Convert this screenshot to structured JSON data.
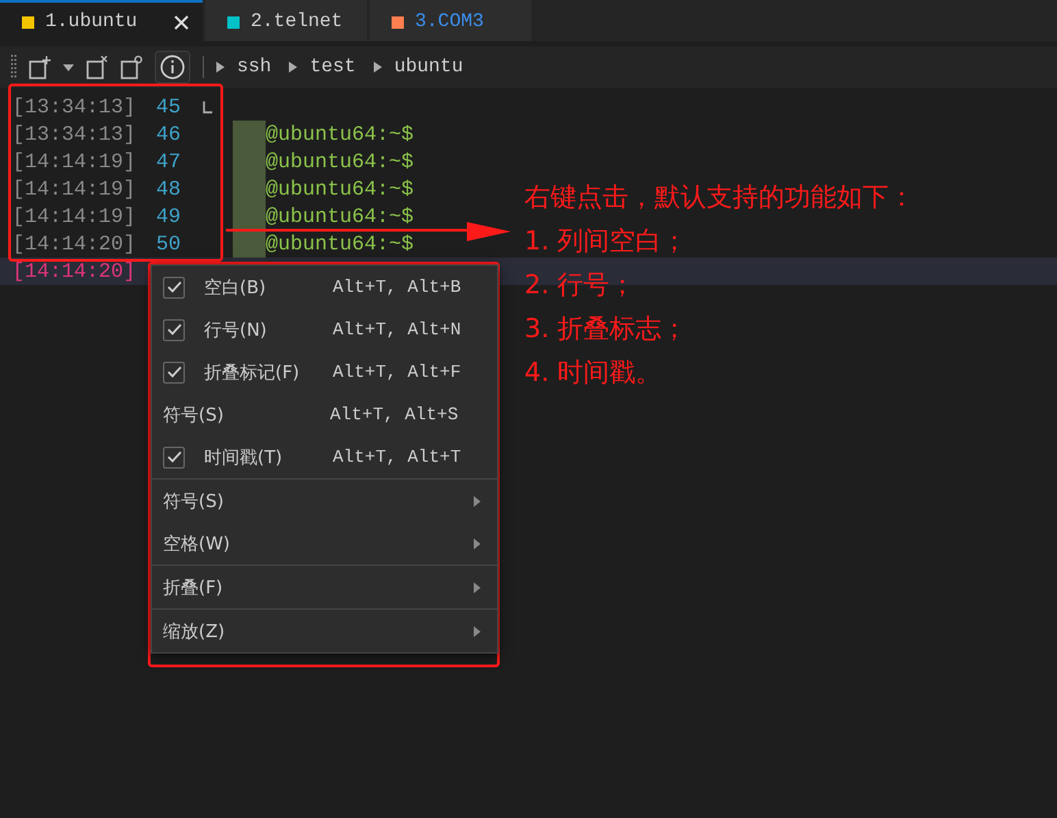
{
  "tabs": [
    {
      "label": "1.ubuntu",
      "selected": true,
      "color": "#f5c400",
      "unread": false
    },
    {
      "label": "2.telnet",
      "selected": false,
      "color": "#00c2c7",
      "unread": false
    },
    {
      "label": "3.COM3",
      "selected": false,
      "color": "#ff7f50",
      "unread": true
    }
  ],
  "breadcrumb": [
    "ssh",
    "test",
    "ubuntu"
  ],
  "lines": [
    {
      "timestamp": "[13:34:13]",
      "line_number": "45",
      "fold_end": true,
      "current": false
    },
    {
      "timestamp": "[13:34:13]",
      "line_number": "46",
      "prompt": "@ubuntu64:~$",
      "current": false
    },
    {
      "timestamp": "[14:14:19]",
      "line_number": "47",
      "prompt": "@ubuntu64:~$",
      "current": false
    },
    {
      "timestamp": "[14:14:19]",
      "line_number": "48",
      "prompt": "@ubuntu64:~$",
      "current": false
    },
    {
      "timestamp": "[14:14:19]",
      "line_number": "49",
      "prompt": "@ubuntu64:~$",
      "current": false
    },
    {
      "timestamp": "[14:14:20]",
      "line_number": "50",
      "prompt": "@ubuntu64:~$",
      "current": false
    },
    {
      "timestamp": "[14:14:20]",
      "current": true
    }
  ],
  "menu": {
    "groups": [
      [
        {
          "kind": "check",
          "label": "空白(B)",
          "shortcut": "Alt+T, Alt+B",
          "checked": true
        },
        {
          "kind": "check",
          "label": "行号(N)",
          "shortcut": "Alt+T, Alt+N",
          "checked": true
        },
        {
          "kind": "check",
          "label": "折叠标记(F)",
          "shortcut": "Alt+T, Alt+F",
          "checked": true
        },
        {
          "kind": "check",
          "label": "符号(S)",
          "shortcut": "Alt+T, Alt+S",
          "checked": false
        },
        {
          "kind": "check",
          "label": "时间戳(T)",
          "shortcut": "Alt+T, Alt+T",
          "checked": true
        }
      ],
      [
        {
          "kind": "submenu",
          "label": "符号(S)"
        },
        {
          "kind": "submenu",
          "label": "空格(W)"
        }
      ],
      [
        {
          "kind": "submenu",
          "label": "折叠(F)"
        }
      ],
      [
        {
          "kind": "submenu",
          "label": "缩放(Z)"
        }
      ]
    ]
  },
  "annotation": {
    "lines": [
      "右键点击，默认支持的功能如下：",
      "1. 列间空白；",
      "2. 行号；",
      "3. 折叠标志；",
      "4. 时间戳。"
    ]
  }
}
